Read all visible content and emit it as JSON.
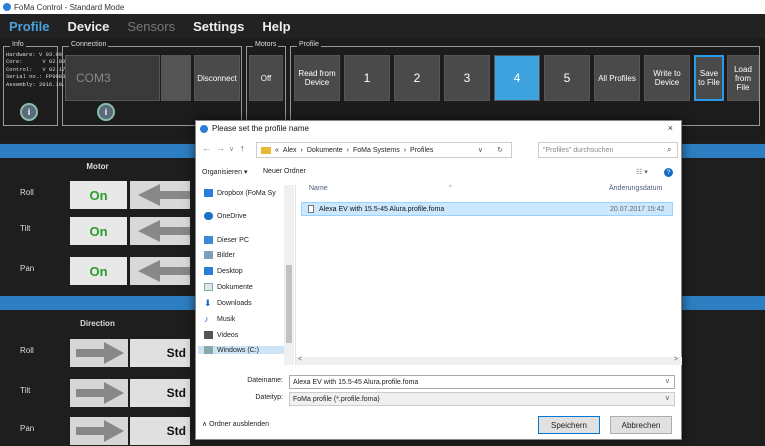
{
  "window": {
    "title": "FoMa Control - Standard Mode"
  },
  "menu": {
    "profile": "Profile",
    "device": "Device",
    "sensors": "Sensors",
    "settings": "Settings",
    "help": "Help"
  },
  "groups": {
    "info": "Info",
    "connection": "Connection",
    "motors": "Motors",
    "profile": "Profile"
  },
  "info": {
    "hardware": "Hardware: V 03.00",
    "core": "Core:      V 02.00.09",
    "control": "Control:   V 02.171",
    "serial": "Serial no.: FP0083",
    "assembly": "Assembly: 2016.10.19"
  },
  "connection": {
    "port": "COM3",
    "disconnect": "Disconnect"
  },
  "motors": {
    "state": "Off"
  },
  "profile": {
    "read": "Read from Device",
    "slots": [
      "1",
      "2",
      "3",
      "4",
      "5"
    ],
    "selected": "4",
    "all": "All Profiles",
    "write": "Write to Device",
    "save": "Save to File",
    "load": "Load from File"
  },
  "motor_section": {
    "title": "Motor",
    "rows": [
      {
        "label": "Roll",
        "state": "On"
      },
      {
        "label": "Tilt",
        "state": "On"
      },
      {
        "label": "Pan",
        "state": "On"
      }
    ]
  },
  "direction_section": {
    "title": "Direction",
    "rows": [
      {
        "label": "Roll",
        "value": "Std"
      },
      {
        "label": "Tilt",
        "value": "Std"
      },
      {
        "label": "Pan",
        "value": "Std"
      }
    ]
  },
  "dialog": {
    "title": "Please set the profile name",
    "close": "×",
    "path": [
      "«",
      "Alex",
      "›",
      "Dokumente",
      "›",
      "FoMa Systems",
      "›",
      "Profiles"
    ],
    "search_placeholder": "\"Profiles\" durchsuchen",
    "organize": "Organisieren ▾",
    "new_folder": "Neuer Ordner",
    "help": "?",
    "nav_items": [
      {
        "label": "Dropbox (FoMa Sy",
        "icon": "dropbox-icon"
      },
      {
        "label": "OneDrive",
        "icon": "onedrive-icon"
      },
      {
        "label": "Dieser PC",
        "icon": "pc-icon"
      },
      {
        "label": "Bilder",
        "icon": "pictures-icon"
      },
      {
        "label": "Desktop",
        "icon": "desktop-icon"
      },
      {
        "label": "Dokumente",
        "icon": "documents-icon"
      },
      {
        "label": "Downloads",
        "icon": "downloads-icon"
      },
      {
        "label": "Musik",
        "icon": "music-icon"
      },
      {
        "label": "Videos",
        "icon": "videos-icon"
      },
      {
        "label": "Windows (C:)",
        "icon": "drive-icon"
      }
    ],
    "columns": {
      "name": "Name",
      "date": "Änderungsdatum"
    },
    "files": [
      {
        "name": "Alexa EV with 15.5-45 Alura.profile.foma",
        "date": "20.07.2017 15:42"
      }
    ],
    "filename_label": "Dateiname:",
    "filename_value": "Alexa EV with 15.5-45 Alura.profile.foma",
    "filetype_label": "Dateityp:",
    "filetype_value": "FoMa profile (*.profile.foma)",
    "hide_folders": "Ordner ausblenden",
    "save": "Speichern",
    "cancel": "Abbrechen"
  },
  "colors": {
    "accent": "#3fa3e0",
    "section_bar": "#2d7fc1",
    "on_green": "#2a9d2a"
  }
}
